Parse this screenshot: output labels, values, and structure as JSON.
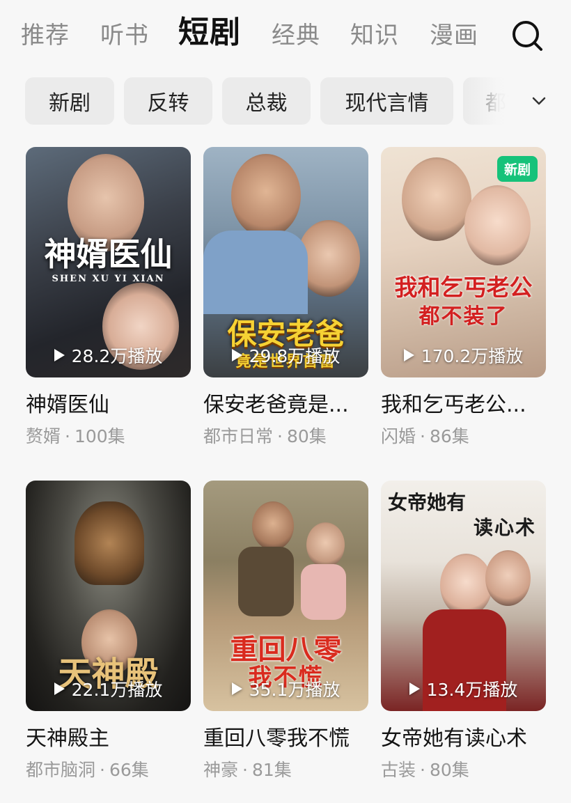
{
  "tabs": [
    {
      "label": "推荐",
      "active": false
    },
    {
      "label": "听书",
      "active": false
    },
    {
      "label": "短剧",
      "active": true
    },
    {
      "label": "经典",
      "active": false
    },
    {
      "label": "知识",
      "active": false
    },
    {
      "label": "漫画",
      "active": false
    }
  ],
  "search": {
    "icon": "search-icon"
  },
  "chips": [
    "新剧",
    "反转",
    "总裁",
    "现代言情",
    "都市"
  ],
  "expand": {
    "icon": "chevron-down-icon"
  },
  "cards": [
    {
      "title": "神婿医仙",
      "poster_title": "神婿医仙",
      "poster_subtitle": "SHEN XU YI XIAN",
      "plays": "28.2万播放",
      "genre": "赘婿",
      "episodes": "100集",
      "badge": ""
    },
    {
      "title": "保安老爸竟是...",
      "poster_title": "保安老爸",
      "poster_subtitle": "竟是世界首富",
      "plays": "29.8万播放",
      "genre": "都市日常",
      "episodes": "80集",
      "badge": ""
    },
    {
      "title": "我和乞丐老公...",
      "poster_title": "我和乞丐老公",
      "poster_subtitle": "都不装了",
      "plays": "170.2万播放",
      "genre": "闪婚",
      "episodes": "86集",
      "badge": "新剧"
    },
    {
      "title": "天神殿主",
      "poster_title": "天神殿",
      "poster_subtitle": "",
      "plays": "22.1万播放",
      "genre": "都市脑洞",
      "episodes": "66集",
      "badge": ""
    },
    {
      "title": "重回八零我不慌",
      "poster_title": "重回八零",
      "poster_subtitle": "我不慌",
      "plays": "35.1万播放",
      "genre": "神豪",
      "episodes": "81集",
      "badge": ""
    },
    {
      "title": "女帝她有读心术",
      "poster_title": "女帝她有",
      "poster_subtitle": "读心术",
      "plays": "13.4万播放",
      "genre": "古装",
      "episodes": "80集",
      "badge": ""
    }
  ],
  "colors": {
    "badge_green": "#16c27a",
    "meta_gray": "#9a9a9a",
    "inactive_tab": "#8a8a8a"
  }
}
